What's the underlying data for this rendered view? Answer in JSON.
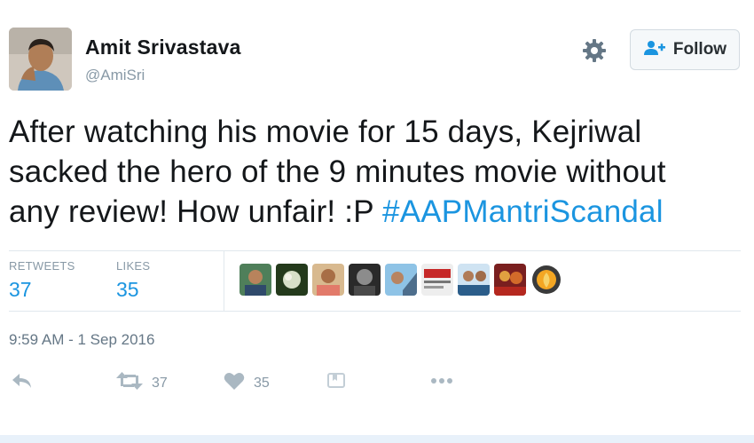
{
  "user": {
    "name": "Amit Srivastava",
    "handle": "@AmiSri"
  },
  "follow_button": {
    "label": "Follow"
  },
  "tweet": {
    "text_lines": [
      "After watching his movie for 15 days, Kejriwal",
      "sacked the hero of the 9 minutes movie without",
      "any review! How unfair! :P "
    ],
    "hashtag": "#AAPMantriScandal"
  },
  "stats": {
    "retweets_label": "RETWEETS",
    "retweets_count": "37",
    "likes_label": "LIKES",
    "likes_count": "35"
  },
  "timestamp": "9:59 AM - 1 Sep 2016",
  "actions": {
    "retweet_count": "37",
    "like_count": "35"
  },
  "colors": {
    "link": "#1b95e0",
    "muted": "#8899a6",
    "text": "#14171a",
    "divider": "#e1e8ed"
  },
  "icons": [
    "gear-icon",
    "follow-user-icon",
    "reply-icon",
    "retweet-icon",
    "heart-icon",
    "add-to-moment-icon",
    "more-icon"
  ]
}
